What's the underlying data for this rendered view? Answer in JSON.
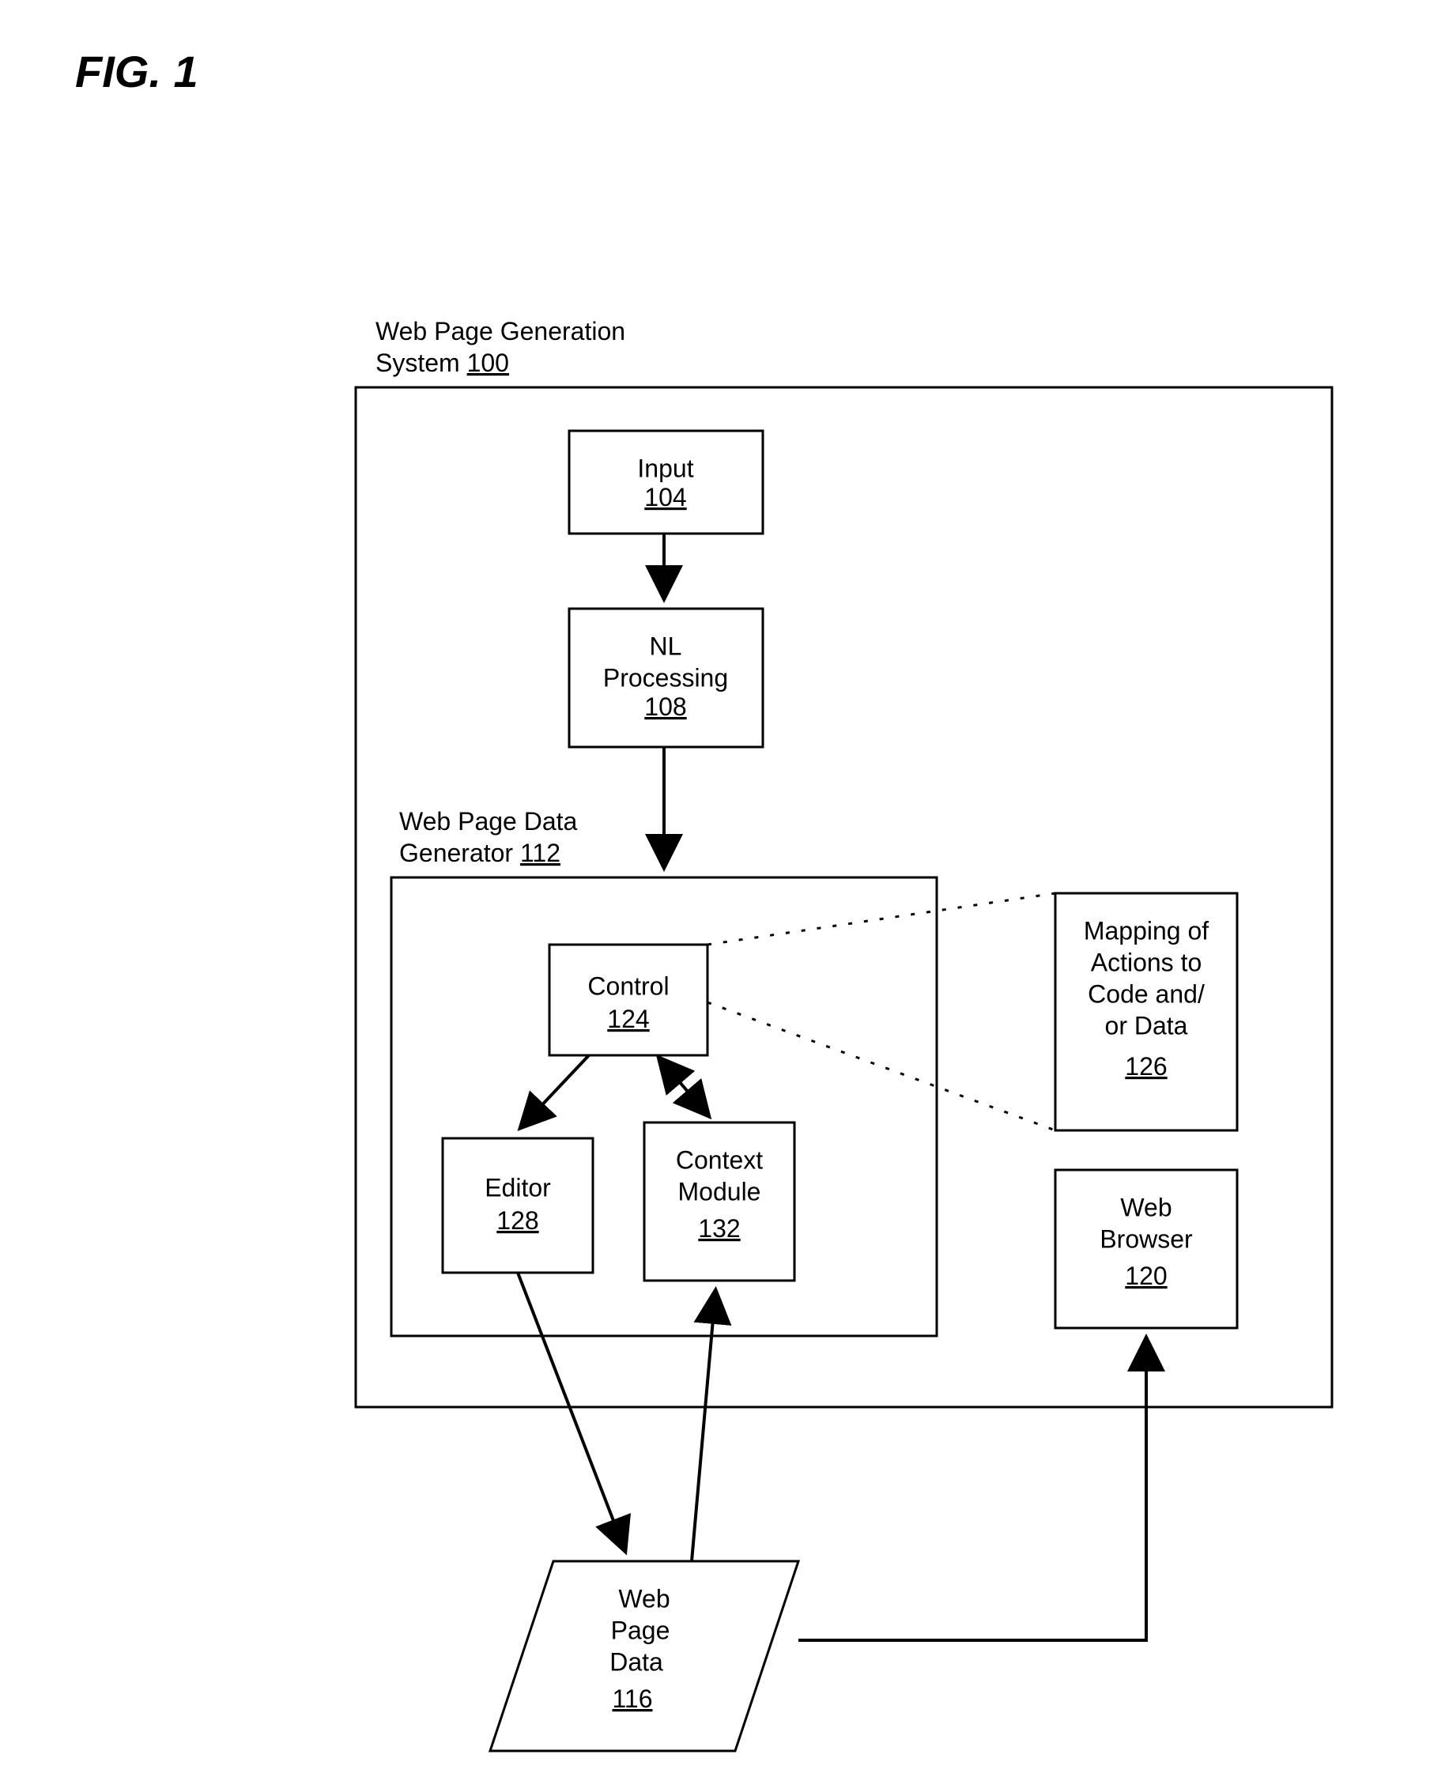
{
  "figure": {
    "title": "FIG. 1"
  },
  "system100": {
    "label_line1": "Web Page Generation",
    "label_line2": "System ",
    "number": "100"
  },
  "input104": {
    "label": "Input",
    "number": "104"
  },
  "nl108": {
    "label_line1": "NL",
    "label_line2": "Processing",
    "number": "108"
  },
  "generator112": {
    "label_line1": "Web Page Data",
    "label_line2": "Generator ",
    "number": "112"
  },
  "control124": {
    "label": "Control",
    "number": "124"
  },
  "editor128": {
    "label": "Editor",
    "number": "128"
  },
  "context132": {
    "label_line1": "Context",
    "label_line2": "Module",
    "number": "132"
  },
  "mapping126": {
    "label_line1": "Mapping of",
    "label_line2": "Actions to",
    "label_line3": "Code and/",
    "label_line4": "or Data",
    "number": "126"
  },
  "browser120": {
    "label_line1": "Web",
    "label_line2": "Browser",
    "number": "120"
  },
  "webdata116": {
    "label_line1": "Web",
    "label_line2": "Page",
    "label_line3": "Data",
    "number": "116"
  }
}
